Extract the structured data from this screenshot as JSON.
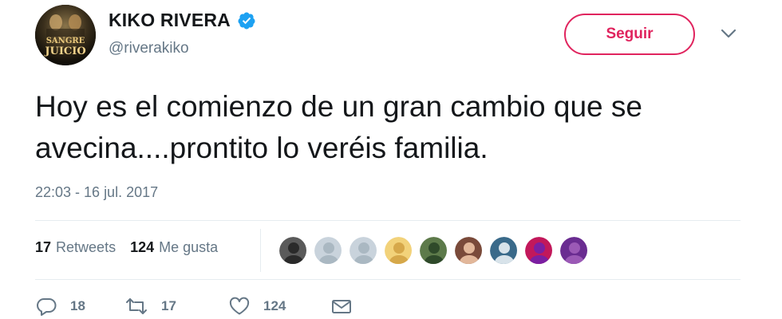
{
  "user": {
    "display_name": "KIKO RIVERA",
    "handle": "@riverakiko",
    "verified": true,
    "avatar_icon": "profile-photo-icon",
    "avatar_text": "SANGRE JUICIO"
  },
  "follow_button": {
    "label": "Seguir",
    "color": "#e0245e"
  },
  "menu_icon": "chevron-down-icon",
  "tweet": {
    "text": "Hoy es el comienzo de un gran cambio que se avecina....prontito lo veréis familia.",
    "timestamp": "22:03 - 16 jul. 2017"
  },
  "stats": {
    "retweets_count": "17",
    "retweets_label": "Retweets",
    "likes_count": "124",
    "likes_label": "Me gusta"
  },
  "likers": [
    {
      "name": "liker-1",
      "colors": [
        "#5a5a5a",
        "#2a2a2a"
      ]
    },
    {
      "name": "liker-2",
      "colors": [
        "#c9d3dc",
        "#aab8c2"
      ]
    },
    {
      "name": "liker-3",
      "colors": [
        "#c9d3dc",
        "#aab8c2"
      ]
    },
    {
      "name": "liker-4",
      "colors": [
        "#f2d27a",
        "#d6a84a"
      ]
    },
    {
      "name": "liker-5",
      "colors": [
        "#5d7a4a",
        "#2f4a2a"
      ]
    },
    {
      "name": "liker-6",
      "colors": [
        "#7a4a3a",
        "#e2b79a"
      ]
    },
    {
      "name": "liker-7",
      "colors": [
        "#3a6a8a",
        "#d8e3ea"
      ]
    },
    {
      "name": "liker-8",
      "colors": [
        "#c2185b",
        "#7b1fa2"
      ]
    },
    {
      "name": "liker-9",
      "colors": [
        "#6a2c91",
        "#9b59b6"
      ]
    }
  ],
  "actions": {
    "reply": {
      "icon": "reply-icon",
      "count": "18"
    },
    "retweet": {
      "icon": "retweet-icon",
      "count": "17"
    },
    "like": {
      "icon": "heart-icon",
      "count": "124"
    },
    "dm": {
      "icon": "envelope-icon"
    }
  },
  "colors": {
    "text": "#14171a",
    "muted": "#657786",
    "verified": "#1da1f2",
    "divider": "#e6ecf0"
  }
}
